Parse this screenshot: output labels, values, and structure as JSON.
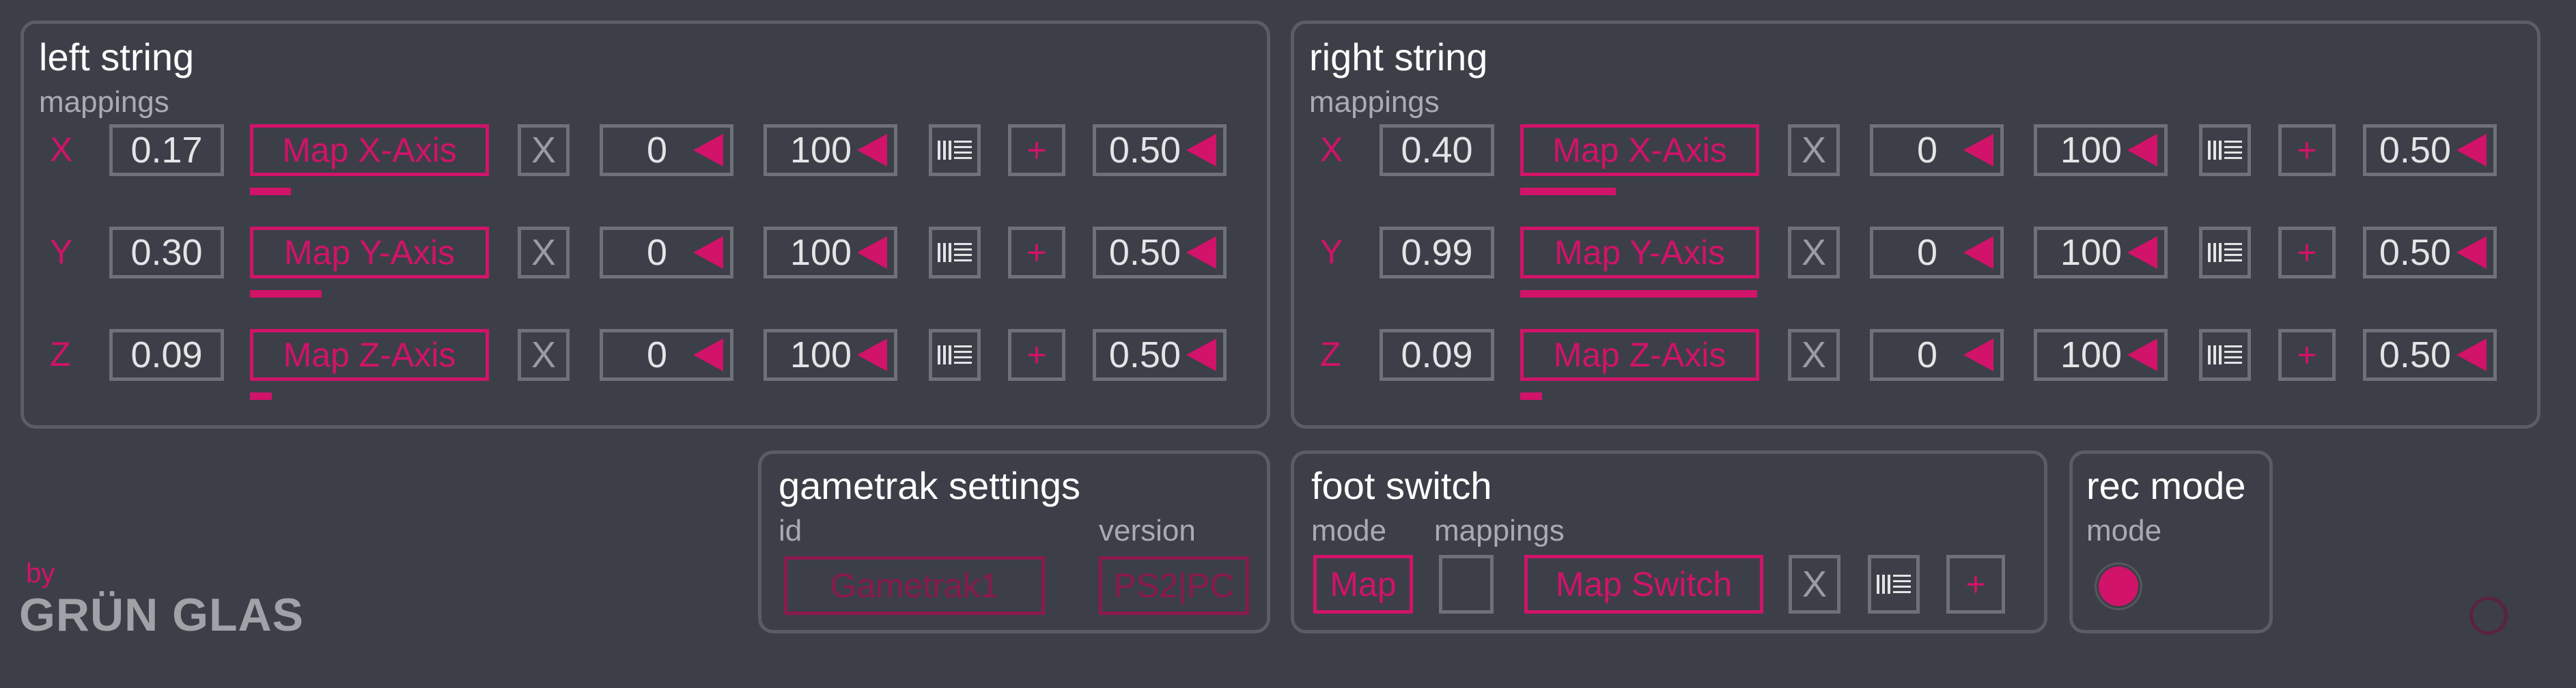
{
  "colors": {
    "accent": "#d11369",
    "background": "#3c3f47",
    "panel_border": "#5a5d65"
  },
  "left": {
    "title": "left string",
    "subtitle": "mappings",
    "rows": [
      {
        "axis": "X",
        "value": "0.17",
        "map_label": "Map X-Axis",
        "x_label": "X",
        "min": "0",
        "max": "100",
        "plus": "+",
        "scale": "0.50",
        "activity": 0.17
      },
      {
        "axis": "Y",
        "value": "0.30",
        "map_label": "Map Y-Axis",
        "x_label": "X",
        "min": "0",
        "max": "100",
        "plus": "+",
        "scale": "0.50",
        "activity": 0.3
      },
      {
        "axis": "Z",
        "value": "0.09",
        "map_label": "Map Z-Axis",
        "x_label": "X",
        "min": "0",
        "max": "100",
        "plus": "+",
        "scale": "0.50",
        "activity": 0.09
      }
    ]
  },
  "right": {
    "title": "right string",
    "subtitle": "mappings",
    "rows": [
      {
        "axis": "X",
        "value": "0.40",
        "map_label": "Map X-Axis",
        "x_label": "X",
        "min": "0",
        "max": "100",
        "plus": "+",
        "scale": "0.50",
        "activity": 0.4
      },
      {
        "axis": "Y",
        "value": "0.99",
        "map_label": "Map Y-Axis",
        "x_label": "X",
        "min": "0",
        "max": "100",
        "plus": "+",
        "scale": "0.50",
        "activity": 0.99
      },
      {
        "axis": "Z",
        "value": "0.09",
        "map_label": "Map Z-Axis",
        "x_label": "X",
        "min": "0",
        "max": "100",
        "plus": "+",
        "scale": "0.50",
        "activity": 0.09
      }
    ]
  },
  "gametrak": {
    "title": "gametrak settings",
    "id_label": "id",
    "version_label": "version",
    "id_value": "Gametrak1",
    "version_value": "PS2|PC"
  },
  "foot": {
    "title": "foot switch",
    "mode_label": "mode",
    "mappings_label": "mappings",
    "mode_value": "Map",
    "map_label": "Map Switch",
    "x_label": "X",
    "plus": "+"
  },
  "rec": {
    "title": "rec mode",
    "mode_label": "mode"
  },
  "credit": {
    "by": "by",
    "name": "GRÜN GLAS"
  }
}
